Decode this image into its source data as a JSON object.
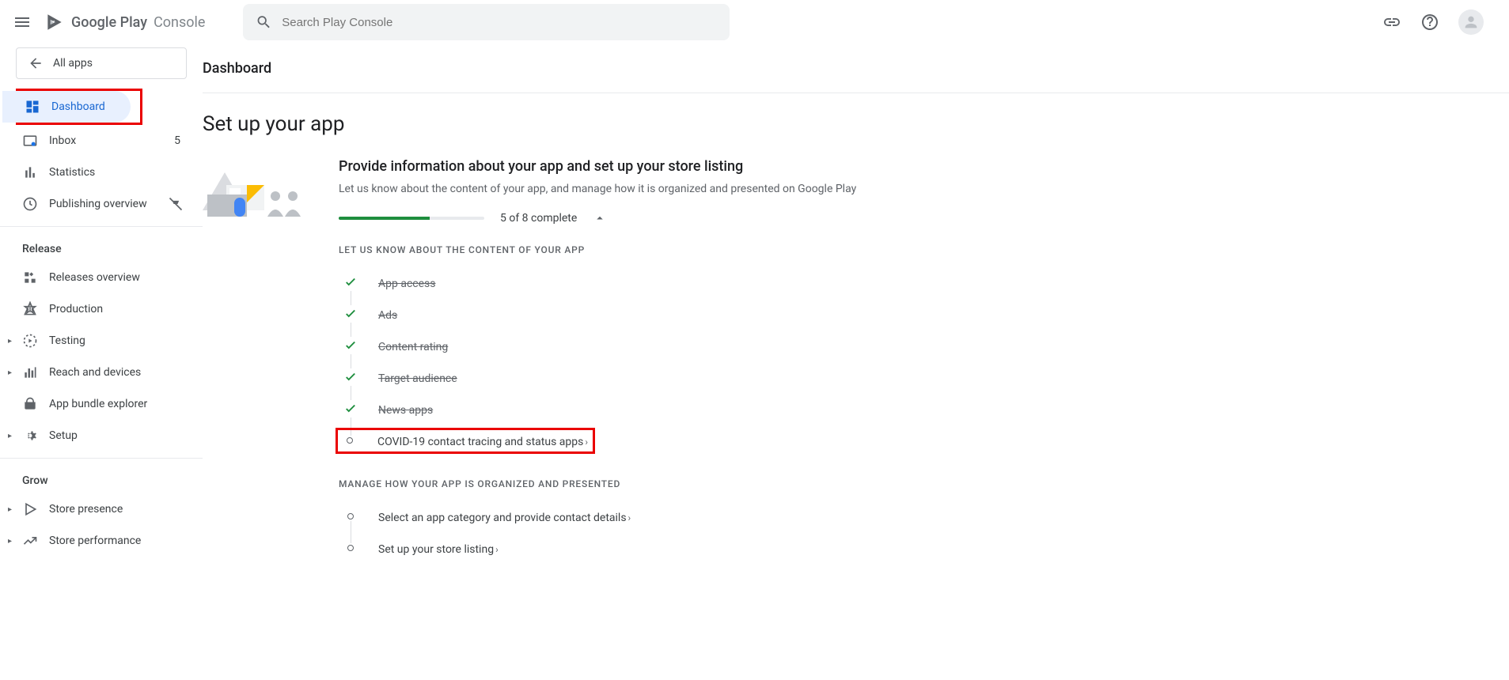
{
  "header": {
    "logo_text1": "Google Play",
    "logo_text2": "Console",
    "search_placeholder": "Search Play Console"
  },
  "sidebar": {
    "all_apps": "All apps",
    "items": [
      {
        "label": "Dashboard"
      },
      {
        "label": "Inbox",
        "badge": "5"
      },
      {
        "label": "Statistics"
      },
      {
        "label": "Publishing overview"
      }
    ],
    "section_release": "Release",
    "release_items": [
      {
        "label": "Releases overview"
      },
      {
        "label": "Production"
      },
      {
        "label": "Testing"
      },
      {
        "label": "Reach and devices"
      },
      {
        "label": "App bundle explorer"
      },
      {
        "label": "Setup"
      }
    ],
    "section_grow": "Grow",
    "grow_items": [
      {
        "label": "Store presence"
      },
      {
        "label": "Store performance"
      }
    ]
  },
  "main": {
    "page_title": "Dashboard",
    "section_heading": "Set up your app",
    "setup": {
      "title": "Provide information about your app and set up your store listing",
      "desc": "Let us know about the content of your app, and manage how it is organized and presented on Google Play",
      "progress_text": "5 of 8 complete",
      "progress_pct": 62.5,
      "sub1_title": "LET US KNOW ABOUT THE CONTENT OF YOUR APP",
      "tasks1": [
        {
          "label": "App access",
          "done": true
        },
        {
          "label": "Ads",
          "done": true
        },
        {
          "label": "Content rating",
          "done": true
        },
        {
          "label": "Target audience",
          "done": true
        },
        {
          "label": "News apps",
          "done": true
        },
        {
          "label": "COVID-19 contact tracing and status apps",
          "done": false,
          "highlight": true
        }
      ],
      "sub2_title": "MANAGE HOW YOUR APP IS ORGANIZED AND PRESENTED",
      "tasks2": [
        {
          "label": "Select an app category and provide contact details",
          "done": false
        },
        {
          "label": "Set up your store listing",
          "done": false
        }
      ]
    }
  }
}
